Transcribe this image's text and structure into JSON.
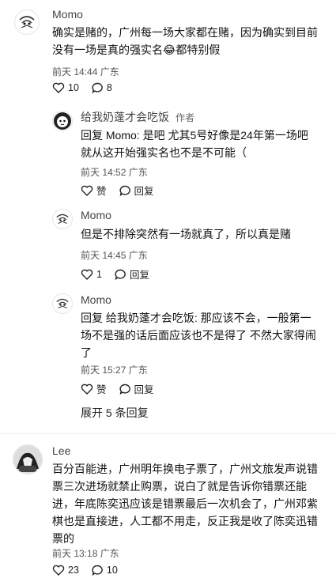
{
  "comments": [
    {
      "name": "Momo",
      "text_line1": "确实是赌的，广州每一场大家都在赌，因为确实到目前",
      "text_line2": "没有一场是真的强实名😂都特别假",
      "meta": "前天 14:44 广东",
      "likes": "10",
      "replies_count": "8",
      "avatar": "bird-sketch"
    },
    {
      "name": "给我奶蓬才会吃饭",
      "author_tag": "作者",
      "text_line1": "回复 Momo: 是吧 尤其5号好像是24年第一场吧",
      "text_line2": "就从这开始强实名也不是不可能（",
      "meta": "前天 14:52 广东",
      "like_label": "赞",
      "reply_label": "回复",
      "avatar": "anime-cat"
    },
    {
      "name": "Momo",
      "text_line1": "但是不排除突然有一场就真了，所以真是赌",
      "meta": "前天 14:45 广东",
      "likes": "1",
      "reply_label": "回复",
      "avatar": "bird-sketch"
    },
    {
      "name": "Momo",
      "text_line1": "回复 给我奶蓬才会吃饭: 那应该不会，一般第一",
      "text_line2": "场不是强的话后面应该也不是得了 不然大家得闹",
      "text_line3": "了",
      "meta": "前天 15:27 广东",
      "like_label": "赞",
      "reply_label": "回复",
      "avatar": "bird-sketch"
    },
    {
      "name": "Lee",
      "text_line1": "百分百能进，广州明年换电子票了，广州文旅发声说错",
      "text_line2": "票三次进场就禁止购票，说白了就是告诉你错票还能",
      "text_line3": "进，年底陈奕迅应该是错票最后一次机会了，广州邓紫",
      "text_line4": "棋也是直接进，人工都不用走，反正我是收了陈奕迅错",
      "text_line5": "票的",
      "meta": "前天 13:18 广东",
      "likes": "23",
      "replies_count": "10",
      "avatar": "black-white-photo"
    }
  ],
  "expand_replies": "展开 5 条回复",
  "icons": {
    "like": "heart-icon",
    "reply": "comment-bubble-icon"
  }
}
